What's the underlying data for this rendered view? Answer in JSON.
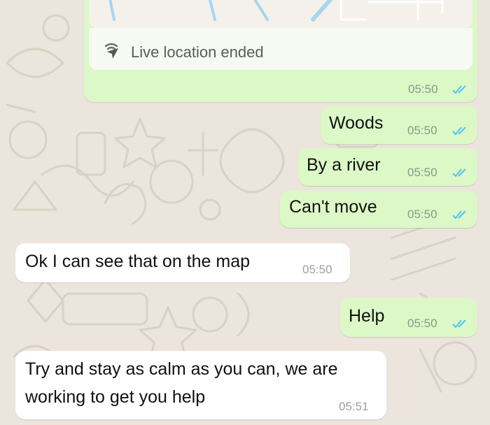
{
  "chat": {
    "location_card": {
      "status_text": "Live location ended",
      "time": "05:50",
      "read_receipt_icon": "double-check-icon"
    },
    "messages": [
      {
        "direction": "outgoing",
        "text": "Woods",
        "time": "05:50"
      },
      {
        "direction": "outgoing",
        "text": "By a river",
        "time": "05:50"
      },
      {
        "direction": "outgoing",
        "text": "Can't move",
        "time": "05:50"
      },
      {
        "direction": "incoming",
        "text": "Ok I can see that on the map",
        "time": "05:50"
      },
      {
        "direction": "outgoing",
        "text": "Help",
        "time": "05:50"
      },
      {
        "direction": "incoming",
        "line1": "Try and stay as calm as you can, we are",
        "line2": "working to get you help",
        "time": "05:51"
      }
    ]
  },
  "colors": {
    "background": "#ece5dd",
    "outgoing_bubble": "#dcf8c6",
    "incoming_bubble": "#ffffff",
    "read_ticks": "#4fc3f7"
  },
  "icons": {
    "location": "live-location-icon",
    "receipt": "double-check-icon"
  }
}
